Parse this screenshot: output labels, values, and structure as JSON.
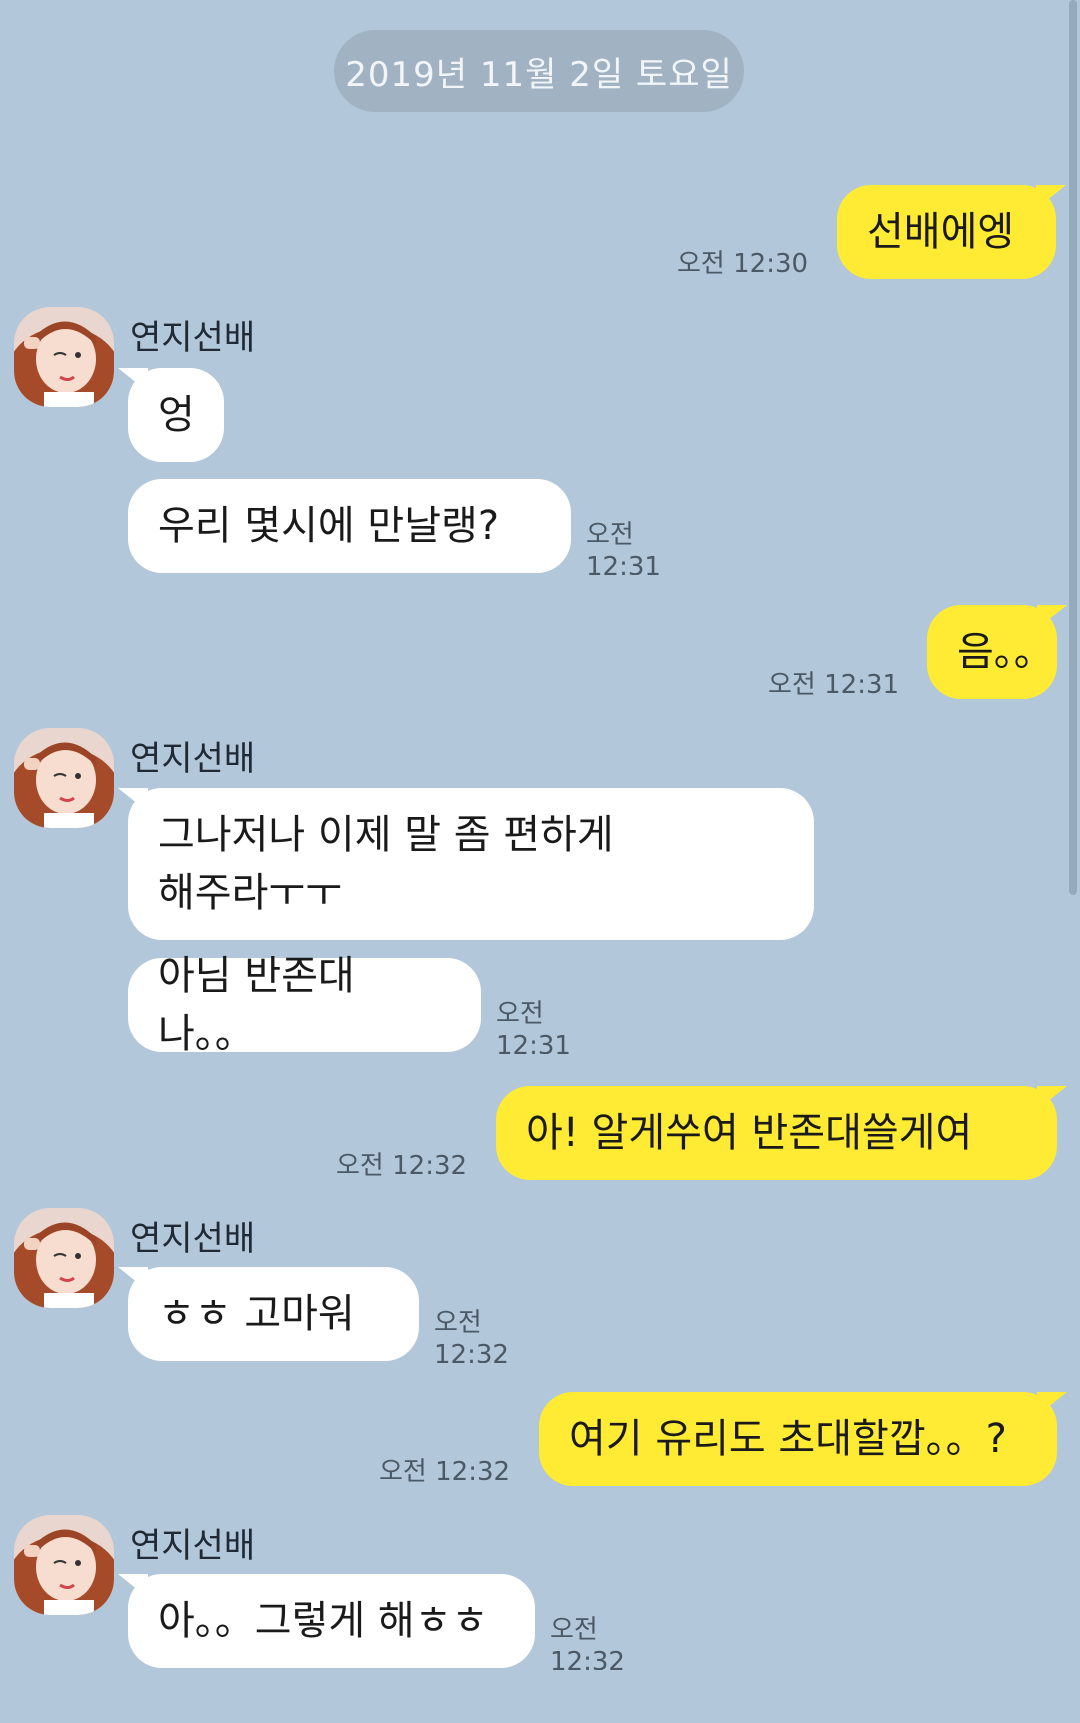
{
  "chat": {
    "date_separator": "2019년 11월 2일 토요일",
    "sender_name": "연지선배",
    "messages": [
      {
        "text": "선배에엥",
        "time": "오전 12:30"
      },
      {
        "text": "엉"
      },
      {
        "text": "우리 몇시에 만날랭?",
        "time": "오전 12:31"
      },
      {
        "text": "음。。",
        "time": "오전 12:31"
      },
      {
        "text_line1": "그나저나 이제 말 좀 편하게",
        "text_line2": "해주라ㅜㅜ"
      },
      {
        "text": "아님 반존대나。。",
        "time": "오전 12:31"
      },
      {
        "text": "아! 알게쑤여 반존대쓸게여",
        "time": "오전 12:32"
      },
      {
        "text": "ㅎㅎ 고마워",
        "time": "오전 12:32"
      },
      {
        "text": "여기 유리도 초대할깝。。?",
        "time": "오전 12:32"
      },
      {
        "text": "아。。그렇게 해ㅎㅎ",
        "time": "오전 12:32"
      }
    ]
  },
  "colors": {
    "background": "#b2c7d9",
    "my_bubble": "#ffeb33",
    "other_bubble": "#ffffff"
  }
}
